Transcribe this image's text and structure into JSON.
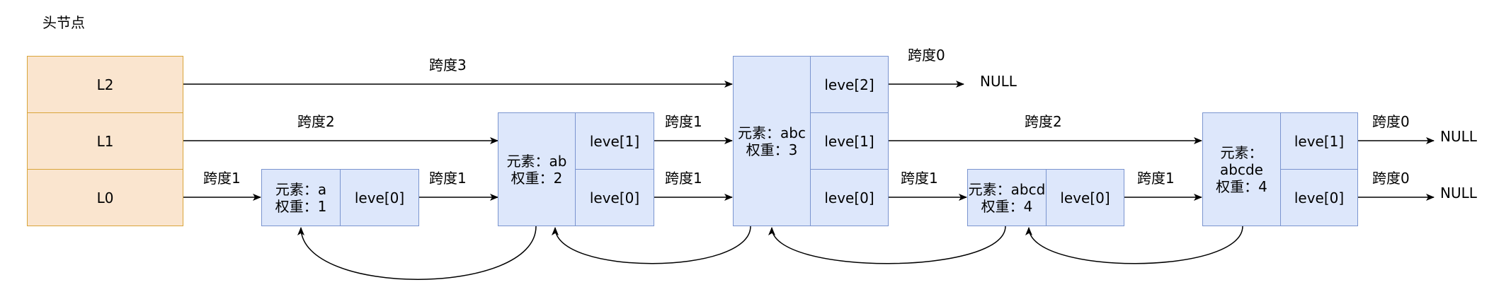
{
  "title": "头节点",
  "head": {
    "levels": [
      "L2",
      "L1",
      "L0"
    ]
  },
  "nodes": [
    {
      "element": "元素：a",
      "weight": "权重：1",
      "levels": [
        "leve[0]"
      ]
    },
    {
      "element": "元素：ab",
      "weight": "权重：2",
      "levels": [
        "leve[1]",
        "leve[0]"
      ]
    },
    {
      "element": "元素：abc",
      "weight": "权重：3",
      "levels": [
        "leve[2]",
        "leve[1]",
        "leve[0]"
      ]
    },
    {
      "element": "元素：abcd",
      "weight": "权重：4",
      "levels": [
        "leve[0]"
      ]
    },
    {
      "element": "元素：",
      "element_value": "abcde",
      "weight": "权重：4",
      "levels": [
        "leve[1]",
        "leve[0]"
      ]
    }
  ],
  "spans": {
    "l2_head": "跨度3",
    "l2_tail": "跨度0",
    "l1_head": "跨度2",
    "l1_ab": "跨度1",
    "l1_abc": "跨度2",
    "l1_tail": "跨度0",
    "l0_head": "跨度1",
    "l0_a": "跨度1",
    "l0_ab": "跨度1",
    "l0_abc": "跨度1",
    "l0_abcd": "跨度1",
    "l0_tail": "跨度0"
  },
  "null_label": "NULL"
}
